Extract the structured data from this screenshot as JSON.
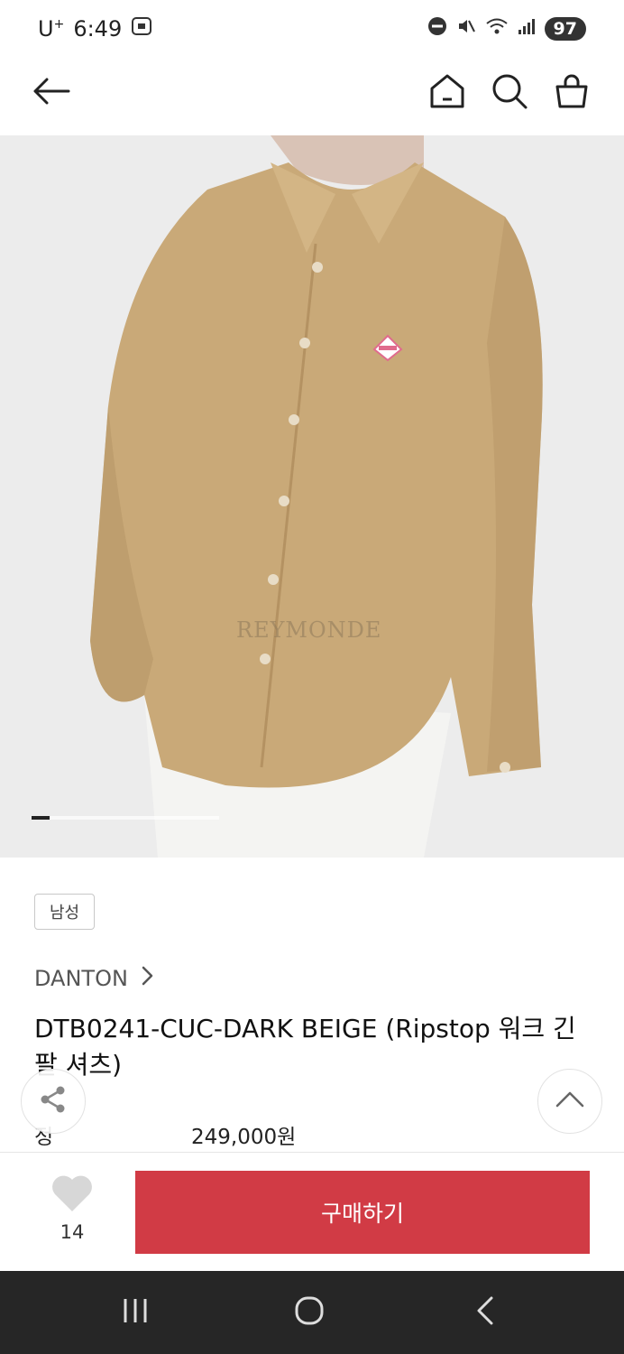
{
  "status_bar": {
    "carrier": "U",
    "carrier_sup": "+",
    "time": "6:49",
    "battery": "97"
  },
  "nav": {
    "back_icon": "arrow-left-icon",
    "home_icon": "home-icon",
    "search_icon": "search-icon",
    "cart_icon": "shopping-bag-icon"
  },
  "hero": {
    "watermark": "REYMONDE",
    "slide_index": 1
  },
  "product": {
    "tag": "남성",
    "brand": "DANTON",
    "title": "DTB0241-CUC-DARK BEIGE (Ripstop 워크 긴팔 셔츠)",
    "price_label": "정찰가",
    "price_value": "249,000원"
  },
  "buy_bar": {
    "like_count": "14",
    "buy_label": "구매하기"
  },
  "colors": {
    "accent": "#d13b45",
    "shirt": "#c9a978",
    "background_image": "#ececec"
  }
}
